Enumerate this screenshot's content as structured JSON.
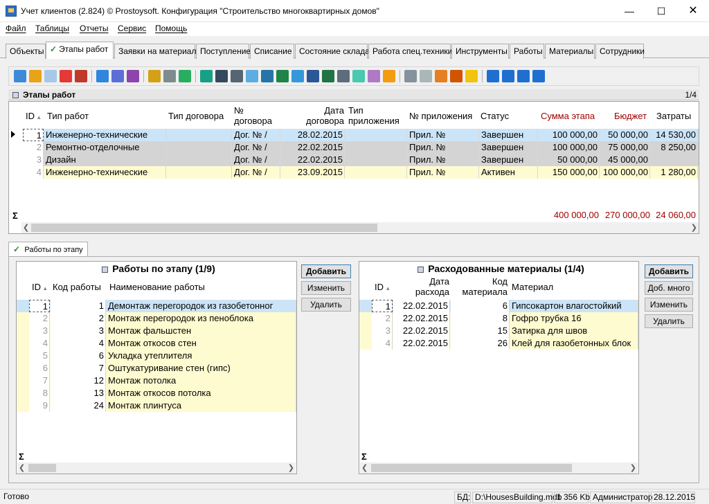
{
  "window": {
    "title": "Учет клиентов (2.824) © Prostoysoft. Конфигурация \"Строительство многоквартирных домов\""
  },
  "menu": [
    "Файл",
    "Таблицы",
    "Отчеты",
    "Сервис",
    "Помощь"
  ],
  "tabs": [
    "Объекты",
    "Этапы работ",
    "Заявки на материал",
    "Поступление",
    "Списание",
    "Состояние склада",
    "Работа спец.техники",
    "Инструменты",
    "Работы",
    "Материалы",
    "Сотрудники"
  ],
  "grid1": {
    "title": "Этапы работ",
    "count": "1/4",
    "headers": {
      "id": "ID",
      "type": "Тип работ",
      "ctype": "Тип договора",
      "cnum1": "№",
      "cnum2": "договора",
      "cdate1": "Дата",
      "cdate2": "договора",
      "atype1": "Тип",
      "atype2": "приложения",
      "anum": "№ приложения",
      "status": "Статус",
      "sum": "Сумма этапа",
      "budget": "Бюджет",
      "costs": "Затраты"
    },
    "rows": [
      {
        "id": "1",
        "type": "Инженерно-технические",
        "ctype": "",
        "cnum": "Дог. № /",
        "cdate": "28.02.2015",
        "atype": "",
        "anum": "Прил. №",
        "status": "Завершен",
        "sum": "100 000,00",
        "budget": "50 000,00",
        "costs": "14 530,00"
      },
      {
        "id": "2",
        "type": "Ремонтно-отделочные",
        "ctype": "",
        "cnum": "Дог. № /",
        "cdate": "22.02.2015",
        "atype": "",
        "anum": "Прил. №",
        "status": "Завершен",
        "sum": "100 000,00",
        "budget": "75 000,00",
        "costs": "8 250,00"
      },
      {
        "id": "3",
        "type": "Дизайн",
        "ctype": "",
        "cnum": "Дог. № /",
        "cdate": "22.02.2015",
        "atype": "",
        "anum": "Прил. №",
        "status": "Завершен",
        "sum": "50 000,00",
        "budget": "45 000,00",
        "costs": ""
      },
      {
        "id": "4",
        "type": "Инженерно-технические",
        "ctype": "",
        "cnum": "Дог. № /",
        "cdate": "23.09.2015",
        "atype": "",
        "anum": "Прил. №",
        "status": "Активен",
        "sum": "150 000,00",
        "budget": "100 000,00",
        "costs": "1 280,00"
      }
    ],
    "totals": {
      "sigma": "Σ",
      "sum": "400 000,00",
      "budget": "270 000,00",
      "costs": "24 060,00"
    }
  },
  "subtab": "Работы по этапу",
  "works": {
    "title": "Работы по этапу (1/9)",
    "headers": {
      "id": "ID",
      "code": "Код работы",
      "name": "Наименование работы"
    },
    "rows": [
      {
        "id": "1",
        "code": "1",
        "name": "Демонтаж перегородок из газобетонног"
      },
      {
        "id": "2",
        "code": "2",
        "name": "Монтаж перегородок из пеноблока"
      },
      {
        "id": "3",
        "code": "3",
        "name": "Монтаж фальшстен"
      },
      {
        "id": "4",
        "code": "4",
        "name": "Монтаж откосов стен"
      },
      {
        "id": "5",
        "code": "6",
        "name": "Укладка утеплителя"
      },
      {
        "id": "6",
        "code": "7",
        "name": "Оштукатуривание стен (гипс)"
      },
      {
        "id": "7",
        "code": "12",
        "name": "Монтаж потолка"
      },
      {
        "id": "8",
        "code": "13",
        "name": "Монтаж откосов потолка"
      },
      {
        "id": "9",
        "code": "24",
        "name": "Монтаж плинтуса"
      }
    ],
    "sigma": "Σ",
    "buttons": {
      "add": "Добавить",
      "edit": "Изменить",
      "del": "Удалить"
    }
  },
  "materials": {
    "title": "Расходованные материалы (1/4)",
    "headers": {
      "id": "ID",
      "date1": "Дата",
      "date2": "расхода",
      "code1": "Код",
      "code2": "материала",
      "name": "Материал"
    },
    "rows": [
      {
        "id": "1",
        "date": "22.02.2015",
        "code": "6",
        "name": "Гипсокартон влагостойкий"
      },
      {
        "id": "2",
        "date": "22.02.2015",
        "code": "8",
        "name": "Гофро трубка 16"
      },
      {
        "id": "3",
        "date": "22.02.2015",
        "code": "15",
        "name": "Затирка для швов"
      },
      {
        "id": "4",
        "date": "22.02.2015",
        "code": "26",
        "name": "Клей для газобетонных блок"
      }
    ],
    "sigma": "Σ",
    "buttons": {
      "add": "Добавить",
      "addmany": "Доб. много",
      "edit": "Изменить",
      "del": "Удалить"
    }
  },
  "status": {
    "ready": "Готово",
    "db_label": "БД:",
    "db_path": "D:\\HousesBuilding.mdb",
    "size": "1 356 Kb",
    "user": "Администратор",
    "date": "28.12.2015"
  },
  "colors": {
    "row_selected": "#cce4f7",
    "row_gray": "#d4d4d4",
    "row_yellow": "#fffbd0",
    "accent_red": "#a00000"
  }
}
